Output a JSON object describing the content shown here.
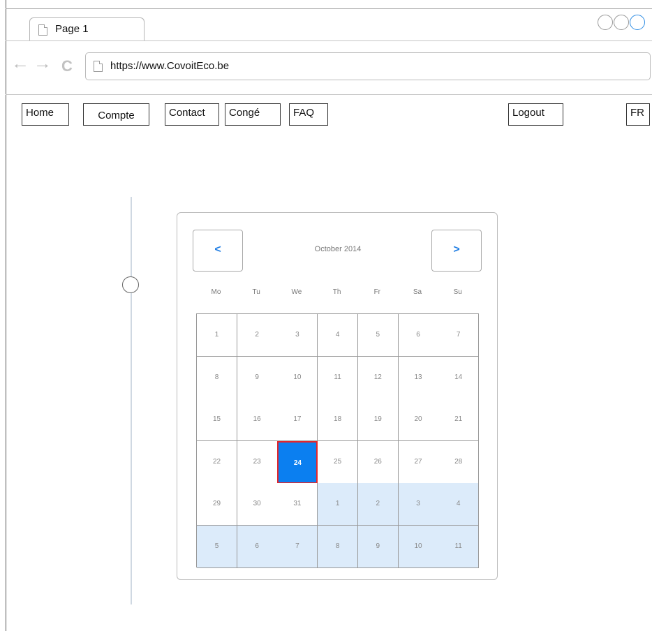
{
  "browser": {
    "tab_title": "Page 1",
    "url": "https://www.CovoitEco.be"
  },
  "menu": {
    "home": "Home",
    "compte": "Compte",
    "contact": "Contact",
    "conge": "Congé",
    "faq": "FAQ",
    "logout": "Logout",
    "lang": "FR"
  },
  "calendar": {
    "month_label": "October 2014",
    "prev_label": "<",
    "next_label": ">",
    "weekdays": [
      "Mo",
      "Tu",
      "We",
      "Th",
      "Fr",
      "Sa",
      "Su"
    ],
    "selected_day": "24",
    "weeks": [
      [
        "1",
        "2",
        "3",
        "4",
        "5",
        "6",
        "7"
      ],
      [
        "8",
        "9",
        "10",
        "11",
        "12",
        "13",
        "14"
      ],
      [
        "15",
        "16",
        "17",
        "18",
        "19",
        "20",
        "21"
      ],
      [
        "22",
        "23",
        "24",
        "25",
        "26",
        "27",
        "28"
      ],
      [
        "29",
        "30",
        "31",
        "1",
        "2",
        "3",
        "4"
      ],
      [
        "5",
        "6",
        "7",
        "8",
        "9",
        "10",
        "11"
      ]
    ],
    "other_month": [
      [
        false,
        false,
        false,
        false,
        false,
        false,
        false
      ],
      [
        false,
        false,
        false,
        false,
        false,
        false,
        false
      ],
      [
        false,
        false,
        false,
        false,
        false,
        false,
        false
      ],
      [
        false,
        false,
        false,
        false,
        false,
        false,
        false
      ],
      [
        false,
        false,
        false,
        true,
        true,
        true,
        true
      ],
      [
        true,
        true,
        true,
        true,
        true,
        true,
        true
      ]
    ]
  },
  "colors": {
    "selected_fill": "#0b7ff0",
    "selected_border": "#e4262b",
    "other_month_fill": "#dcebfa",
    "nav_arrow": "#1f7de3"
  },
  "icons": {
    "back": "arrow-left-icon",
    "forward": "arrow-right-icon",
    "reload": "reload-icon",
    "page": "page-icon"
  }
}
